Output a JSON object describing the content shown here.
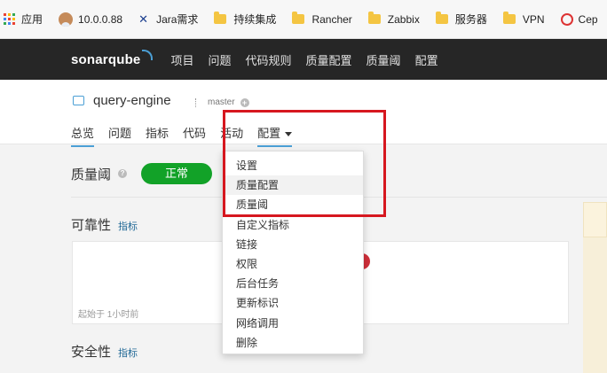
{
  "bookmarks": [
    {
      "label": "应用",
      "icon": "apps-grid-icon"
    },
    {
      "label": "10.0.0.88",
      "icon": "jenkins-avatar-icon"
    },
    {
      "label": "Jara需求",
      "icon": "jira-icon"
    },
    {
      "label": "持续集成",
      "icon": "folder-icon"
    },
    {
      "label": "Rancher",
      "icon": "folder-icon"
    },
    {
      "label": "Zabbix",
      "icon": "folder-icon"
    },
    {
      "label": "服务器",
      "icon": "folder-icon"
    },
    {
      "label": "VPN",
      "icon": "folder-icon"
    },
    {
      "label": "Cep",
      "icon": "ceph-icon"
    }
  ],
  "nav": {
    "logo": "sonarqube",
    "items": [
      "项目",
      "问题",
      "代码规则",
      "质量配置",
      "质量阈",
      "配置"
    ]
  },
  "project": {
    "name": "query-engine",
    "branch": "master",
    "tabs": [
      "总览",
      "问题",
      "指标",
      "代码",
      "活动",
      "配置"
    ]
  },
  "quality_gate": {
    "label": "质量阈",
    "status": "正常"
  },
  "sections": {
    "reliability": {
      "title": "可靠性",
      "link": "指标",
      "note": "起始于 1小时前"
    },
    "security": {
      "title": "安全性",
      "link": "指标"
    }
  },
  "dropdown": {
    "items": [
      "设置",
      "质量配置",
      "质量阈",
      "自定义指标",
      "链接",
      "权限",
      "后台任务",
      "更新标识",
      "网络调用",
      "删除"
    ]
  },
  "colors": {
    "nav_bg": "#262626",
    "accent": "#4b9fd5",
    "status_ok": "#12a228",
    "highlight": "#d6171f"
  }
}
